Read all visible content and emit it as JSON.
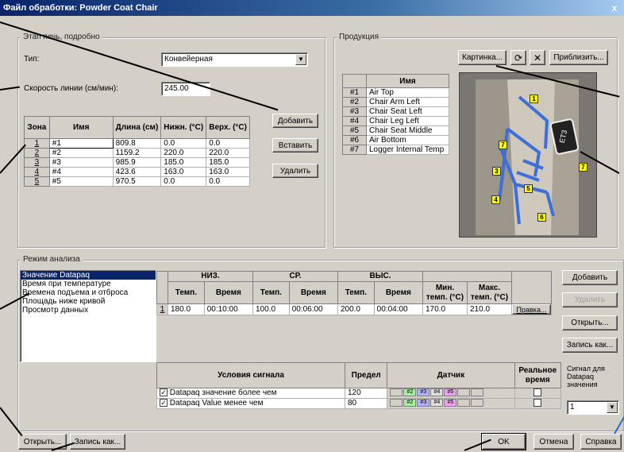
{
  "window": {
    "title": "Файл обработки: Powder Coat Chair",
    "close": "x"
  },
  "oven": {
    "group_title": "Этап печь, подробно",
    "type_label": "Тип:",
    "type_value": "Конвейерная",
    "speed_label": "Скорость линии (см/мин):",
    "speed_value": "245.00",
    "buttons": {
      "add": "Добавить",
      "insert": "Вставить",
      "delete": "Удалить"
    },
    "table": {
      "headers": [
        "Зона",
        "Имя",
        "Длина (см)",
        "Нижн. (°C)",
        "Верх. (°C)"
      ],
      "rows": [
        [
          "1",
          "#1",
          "809.8",
          "0.0",
          "0.0"
        ],
        [
          "2",
          "#2",
          "1159.2",
          "220.0",
          "220.0"
        ],
        [
          "3",
          "#3",
          "985.9",
          "185.0",
          "185.0"
        ],
        [
          "4",
          "#4",
          "423.6",
          "163.0",
          "163.0"
        ],
        [
          "5",
          "#5",
          "970.5",
          "0.0",
          "0.0"
        ]
      ]
    }
  },
  "product": {
    "group_title": "Продукция",
    "picture_button": "Картинка...",
    "zoom_button": "Приблизить...",
    "list_header": "Имя",
    "items": [
      [
        "#1",
        "Air Top"
      ],
      [
        "#2",
        "Chair Arm Left"
      ],
      [
        "#3",
        "Chair Seat Left"
      ],
      [
        "#4",
        "Chair Leg Left"
      ],
      [
        "#5",
        "Chair Seat Middle"
      ],
      [
        "#6",
        "Air Bottom"
      ],
      [
        "#7",
        "Logger Internal Temp"
      ]
    ],
    "photo_tags": [
      "1",
      "7",
      "3",
      "7",
      "5",
      "4",
      "6"
    ]
  },
  "analysis": {
    "group_title": "Режим анализа",
    "modes": [
      "Значение Datapaq",
      "Время при температуре",
      "Времена подъема и отброса",
      "Площадь ниже кривой",
      "Просмотр данных"
    ],
    "selected_mode": 0,
    "headers_top": [
      "НИЗ.",
      "СР.",
      "ВЫС."
    ],
    "headers_sub": [
      "Темп.",
      "Время",
      "Темп.",
      "Время",
      "Темп.",
      "Время",
      "Мин. темп. (°C)",
      "Макс. темп. (°C)"
    ],
    "row": {
      "num": "1",
      "values": [
        "180.0",
        "00:10:00",
        "100.0",
        "00:06:00",
        "200.0",
        "00:04:00",
        "170.0",
        "210.0"
      ],
      "rule_button": "Правка..."
    },
    "side_buttons": {
      "add": "Добавить",
      "delete": "Удалить",
      "open": "Открыть...",
      "save_as": "Запись как..."
    }
  },
  "signal": {
    "headers": {
      "conditions": "Условия сигнала",
      "limit": "Предел",
      "sensor": "Датчик",
      "realtime": "Реальное время"
    },
    "rows": [
      {
        "checked": true,
        "text": "Datapaq значение более чем",
        "limit": "120",
        "sensors": [
          "",
          "#2",
          "#3",
          "#4",
          "#5",
          "",
          ""
        ]
      },
      {
        "checked": true,
        "text": "Datapaq Value менее чем",
        "limit": "80",
        "sensors": [
          "",
          "#2",
          "#3",
          "#4",
          "#5",
          "",
          ""
        ]
      }
    ],
    "signal_label": "Сигнал для Datapaq значения",
    "signal_value": "1"
  },
  "footer": {
    "open": "Открыть...",
    "save_as": "Запись как...",
    "ok": "OK",
    "cancel": "Отмена",
    "help": "Справка"
  },
  "colors": {
    "title_start": "#0a246a",
    "selection": "#0a246a",
    "dialog_bg": "#d4d0c8",
    "tag_yellow": "#ffff00",
    "sensor_green": "#a0f0a0",
    "sensor_blue": "#b0b0ff",
    "sensor_pink": "#f0a0f0"
  }
}
